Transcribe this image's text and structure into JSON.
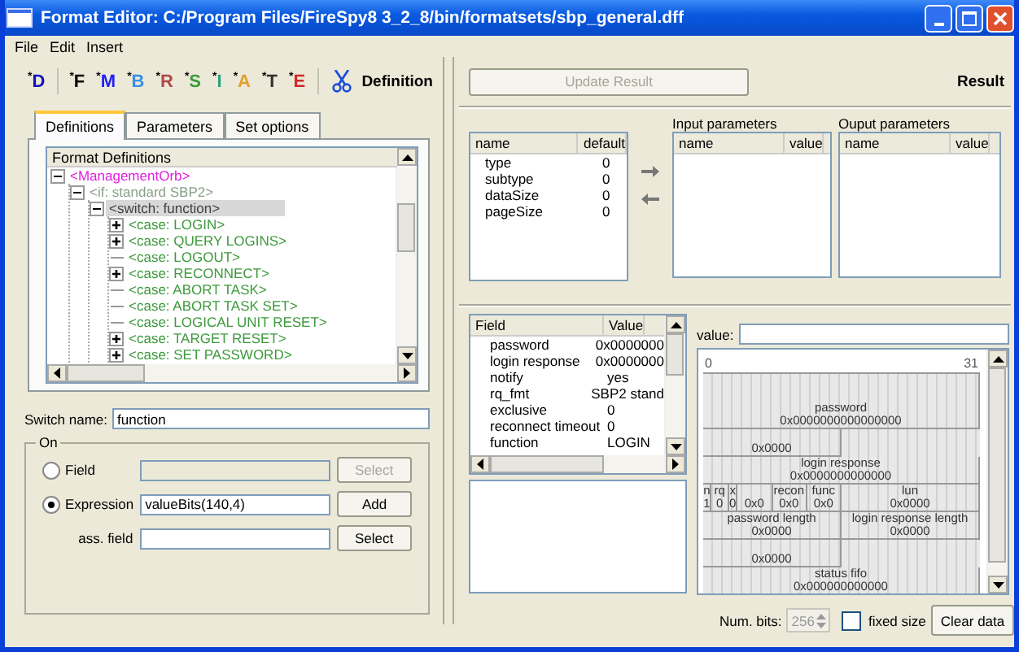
{
  "window": {
    "title": "Format Editor: C:/Program Files/FireSpy8 3_2_8/bin/formatsets/sbp_general.dff"
  },
  "menu": [
    "File",
    "Edit",
    "Insert"
  ],
  "toolbar": {
    "buttons": [
      {
        "label": "$^{*}$D",
        "color": "#1010c0"
      },
      {
        "label": "$^{*}$F",
        "color": "#000000"
      },
      {
        "label": "$^{*}$M",
        "color": "#2020ff"
      },
      {
        "label": "$^{*}$B",
        "color": "#3a8ee8"
      },
      {
        "label": "$^{*}$R",
        "color": "#b04848"
      },
      {
        "label": "$^{*}$S",
        "color": "#3c9a3c"
      },
      {
        "label": "$^{*}$I",
        "color": "#2aa080"
      },
      {
        "label": "$^{*}$A",
        "color": "#e0a030"
      },
      {
        "label": "$^{*}$T",
        "color": "#303030"
      },
      {
        "label": "$^{*}$E",
        "color": "#d02828"
      }
    ],
    "title": "Definition"
  },
  "tabs": [
    {
      "label": "Definitions",
      "selected": true
    },
    {
      "label": "Parameters",
      "selected": false
    },
    {
      "label": "Set options",
      "selected": false
    }
  ],
  "tree": {
    "header": "Format Definitions",
    "nodes": [
      {
        "label": "<ManagementOrb>",
        "color": "#e020e0",
        "kind": "branch",
        "expanded": true,
        "selected": false,
        "children": [
          {
            "label": "<if: standard SBP2>",
            "color": "#88a088",
            "kind": "branch",
            "expanded": true,
            "selected": false,
            "children": [
              {
                "label": "<switch: function>",
                "color": "#404040",
                "kind": "branch",
                "expanded": true,
                "selected": true,
                "children": [
                  {
                    "label": "<case: LOGIN>",
                    "color": "#3c9a3c",
                    "kind": "branch",
                    "expanded": false,
                    "selected": false
                  },
                  {
                    "label": "<case: QUERY LOGINS>",
                    "color": "#3c9a3c",
                    "kind": "branch",
                    "expanded": false,
                    "selected": false
                  },
                  {
                    "label": "<case: LOGOUT>",
                    "color": "#3c9a3c",
                    "kind": "leaf",
                    "selected": false
                  },
                  {
                    "label": "<case: RECONNECT>",
                    "color": "#3c9a3c",
                    "kind": "branch",
                    "expanded": false,
                    "selected": false
                  },
                  {
                    "label": "<case: ABORT TASK>",
                    "color": "#3c9a3c",
                    "kind": "leaf",
                    "selected": false
                  },
                  {
                    "label": "<case: ABORT TASK SET>",
                    "color": "#3c9a3c",
                    "kind": "leaf",
                    "selected": false
                  },
                  {
                    "label": "<case: LOGICAL UNIT RESET>",
                    "color": "#3c9a3c",
                    "kind": "leaf",
                    "selected": false
                  },
                  {
                    "label": "<case: TARGET RESET>",
                    "color": "#3c9a3c",
                    "kind": "branch",
                    "expanded": false,
                    "selected": false
                  },
                  {
                    "label": "<case: SET PASSWORD>",
                    "color": "#3c9a3c",
                    "kind": "branch",
                    "expanded": false,
                    "selected": false
                  }
                ]
              }
            ]
          }
        ]
      }
    ]
  },
  "switch_name": {
    "label": "Switch name:",
    "value": "function"
  },
  "on_group": {
    "title": "On",
    "options": [
      {
        "label": "Field",
        "selected": false,
        "button": {
          "label": "Select",
          "disabled": true
        }
      },
      {
        "label": "Expression",
        "selected": true,
        "value": "valueBits(140,4)",
        "button": {
          "label": "Add",
          "disabled": false
        }
      }
    ],
    "ass_field": {
      "label": "ass. field",
      "button": {
        "label": "Select",
        "disabled": false
      }
    }
  },
  "update_button": {
    "label": "Update Result",
    "disabled": true
  },
  "result_label": "Result",
  "parameters": {
    "columns": [
      "name",
      "default"
    ],
    "rows": [
      [
        "type",
        "0"
      ],
      [
        "subtype",
        "0"
      ],
      [
        "dataSize",
        "0"
      ],
      [
        "pageSize",
        "0"
      ]
    ]
  },
  "input_parameters": {
    "title": "Input parameters",
    "columns": [
      "name",
      "value"
    ]
  },
  "output_parameters": {
    "title": "Ouput parameters",
    "columns": [
      "name",
      "value"
    ]
  },
  "fields_table": {
    "columns": [
      "Field",
      "Value"
    ],
    "rows": [
      [
        "password",
        "0x0000000"
      ],
      [
        "login response",
        "0x0000000"
      ],
      [
        "notify",
        "yes"
      ],
      [
        "rq_fmt",
        "SBP2 stand"
      ],
      [
        "exclusive",
        "0"
      ],
      [
        "reconnect timeout",
        "0"
      ],
      [
        "function",
        "LOGIN"
      ]
    ]
  },
  "value_field": {
    "label": "value:"
  },
  "bit_map": {
    "start": "0",
    "end": "31",
    "fields": [
      {
        "name": "password",
        "value": "0x0000000000000000"
      },
      {
        "value": "0x0000"
      },
      {
        "name": "login response",
        "value": "0x0000000000000"
      },
      {
        "name": "n",
        "value": "1"
      },
      {
        "name": "rq",
        "value": "0"
      },
      {
        "name": "x",
        "value": "0"
      },
      {
        "value": "0x0"
      },
      {
        "name": "recon",
        "value": "0x0"
      },
      {
        "name": "func",
        "value": "0x0"
      },
      {
        "name": "lun",
        "value": "0x0000"
      },
      {
        "name": "password length",
        "value": "0x0000"
      },
      {
        "name": "login response length",
        "value": "0x0000"
      },
      {
        "value": "0x0000"
      },
      {
        "name": "status fifo",
        "value": "0x000000000000"
      }
    ]
  },
  "num_bits": {
    "label": "Num. bits:",
    "value": "256",
    "disabled": true
  },
  "fixed_size": {
    "label": "fixed size",
    "checked": false
  },
  "clear_button": {
    "label": "Clear data"
  }
}
